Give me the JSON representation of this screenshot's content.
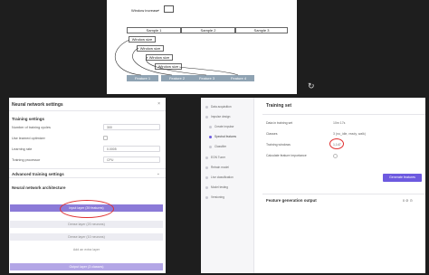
{
  "diagram": {
    "window_increase_label": "Window increase",
    "samples": [
      "Sample 1",
      "Sample 2",
      "Sample 3"
    ],
    "window_size_labels": [
      "Window size",
      "Window size",
      "Window size",
      "Window size"
    ],
    "features": [
      "Feature 1",
      "Feature 2",
      "Feature 3",
      "Feature 4"
    ]
  },
  "left_panel": {
    "title": "Neural network settings",
    "close_glyph": "×",
    "training_settings_title": "Training settings",
    "fields": [
      {
        "label": "Number of training cycles",
        "value": "300",
        "kind": "input"
      },
      {
        "label": "Use learned optimizer",
        "value": "",
        "kind": "check"
      },
      {
        "label": "Learning rate",
        "value": "0.0005",
        "kind": "input"
      },
      {
        "label": "Training processor",
        "value": "CPU",
        "kind": "input"
      }
    ],
    "advanced_title": "Advanced training settings",
    "chevron": "⌄",
    "architecture_title": "Neural network architecture",
    "layers": {
      "input": "Input layer (39 features)",
      "dense1": "Dense layer (20 neurons)",
      "dense2": "Dense layer (10 neurons)",
      "add": "Add an extra layer",
      "output": "Output layer (3 classes)"
    }
  },
  "right_panel": {
    "sidebar_items": [
      "Data acquisition",
      "Impulse design",
      "Create impulse",
      "Spectral features",
      "Classifier",
      "EON Tuner",
      "Retrain model",
      "Live classification",
      "Model testing",
      "Versioning"
    ],
    "training_set_title": "Training set",
    "rows": [
      {
        "label": "Data in training set",
        "value": "10m 17s"
      },
      {
        "label": "Classes",
        "value": "3 (no_idle, ready, walk)"
      },
      {
        "label": "Training windows",
        "value": "1,147"
      },
      {
        "label": "Calculate feature importance",
        "value": ""
      }
    ],
    "generate_button": "Generate features",
    "feature_output_title": "Feature generation output",
    "feature_output_tools": "0 ⊘ ⊙"
  },
  "rotate_glyph": "↻"
}
